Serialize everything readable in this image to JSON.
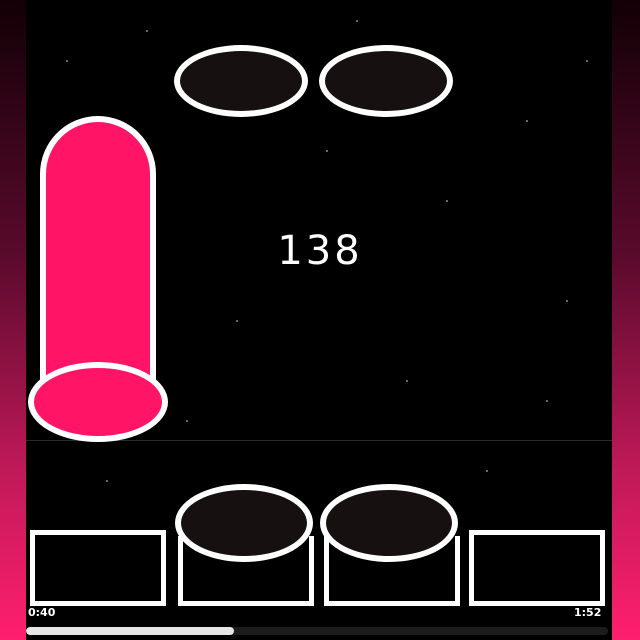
{
  "game": {
    "score": "138",
    "hold_note_color": "#ff1466",
    "note_outline_color": "#ffffff",
    "side_glow_color": "#ff1f6e"
  },
  "notes": {
    "falling": [
      "oval-note",
      "oval-note",
      "hold-note"
    ],
    "lanes": 4
  },
  "playback": {
    "elapsed": "0:40",
    "total": "1:52",
    "progress_fraction": 0.357
  }
}
